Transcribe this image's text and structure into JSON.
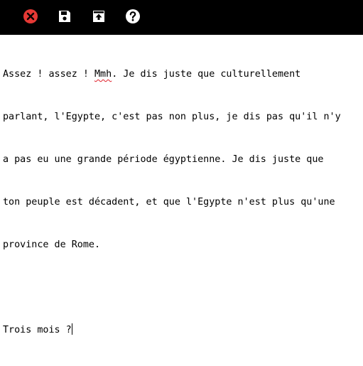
{
  "toolbar": {
    "buttons": [
      {
        "icon": "close-icon",
        "color": "#e53935"
      },
      {
        "icon": "save-icon",
        "color": "#ffffff"
      },
      {
        "icon": "upload-icon",
        "color": "#ffffff"
      },
      {
        "icon": "help-icon",
        "color": "#ffffff"
      }
    ]
  },
  "editor": {
    "line1_a": "Assez ! assez ! ",
    "line1_spell": "Mmh",
    "line1_b": ". Je dis juste que culturellement",
    "line2": "parlant, l'Egypte, c'est pas non plus, je dis pas qu'il n'y",
    "line3": "a pas eu une grande période égyptienne. Je dis juste que",
    "line4": "ton peuple est décadent, et que l'Egypte n'est plus qu'une",
    "line5": "province de Rome.",
    "line6": "",
    "line7": "Trois mois ?"
  }
}
